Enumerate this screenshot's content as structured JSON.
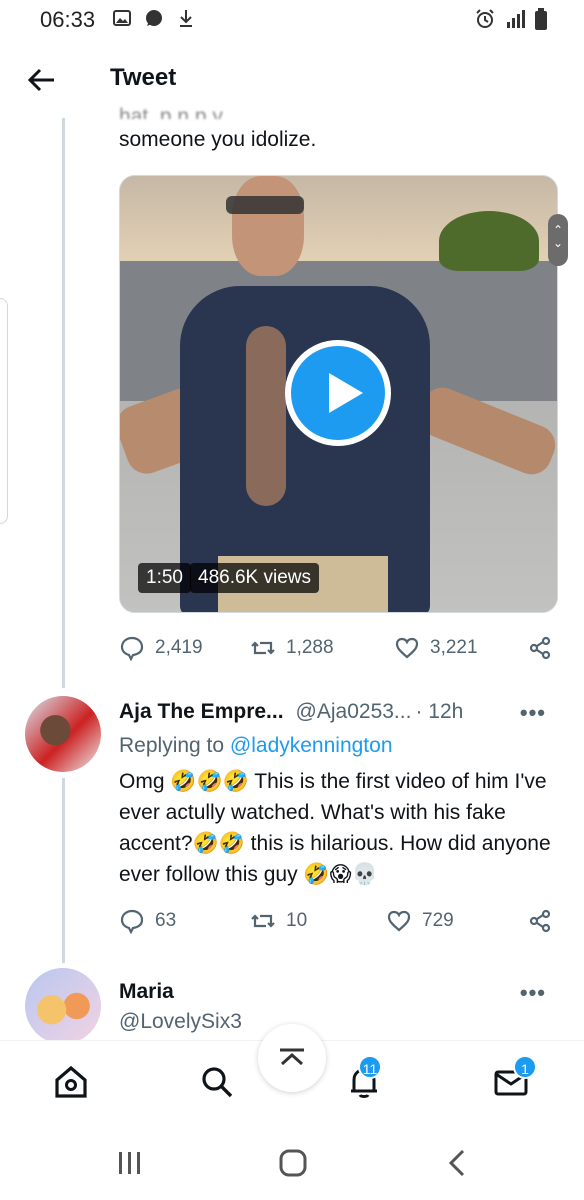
{
  "status_bar": {
    "time": "06:33",
    "left_icons": [
      "image-icon",
      "chat-bubble-icon",
      "download-icon"
    ],
    "right_icons": [
      "alarm-icon",
      "signal-icon",
      "battery-icon"
    ]
  },
  "header": {
    "title": "Tweet",
    "back_icon": "back-arrow-icon"
  },
  "main_tweet": {
    "partial_text_top": "hat, p      n     p           y    ",
    "text_line": "someone you idolize.",
    "video": {
      "duration": "1:50",
      "views": "486.6K views",
      "play_icon": "play-icon"
    },
    "actions": {
      "replies": "2,419",
      "retweets": "1,288",
      "likes": "3,221"
    }
  },
  "reply_1": {
    "author_name": "Aja The Empre...",
    "handle": "@Aja0253...",
    "time": "· 12h",
    "replying_prefix": "Replying to",
    "replying_to": "@ladykennington",
    "body": "Omg 🤣🤣🤣 This is the first video of him I've ever actully watched. What's with his fake accent?🤣🤣 this is hilarious. How did anyone ever follow this guy 🤣😱💀",
    "actions": {
      "replies": "63",
      "retweets": "10",
      "likes": "729"
    }
  },
  "reply_2": {
    "author_name": "Maria",
    "handle": "@LovelySix3"
  },
  "more_label": "•••",
  "bottom_nav": {
    "items": [
      "home-icon",
      "search-icon",
      "notifications-icon",
      "messages-icon"
    ],
    "notifications_badge": "11",
    "messages_badge": "1"
  },
  "scroll_arrows": "⌃\n⌄",
  "colors": {
    "accent": "#1d9bf0",
    "text_primary": "#0f1419",
    "text_secondary": "#536471",
    "thread_line": "#cfd9de"
  }
}
